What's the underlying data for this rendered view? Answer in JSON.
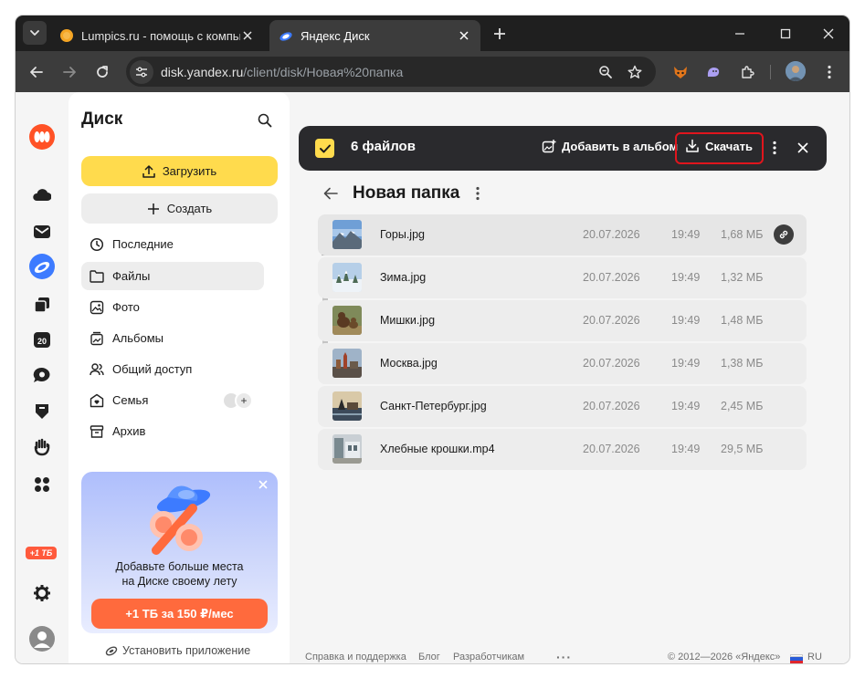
{
  "browser": {
    "tabs": [
      {
        "title": "Lumpics.ru - помощь с компьютером",
        "favicon": "orange-circle-icon"
      },
      {
        "title": "Яндекс Диск",
        "favicon": "yandex-disk-icon"
      }
    ],
    "url": {
      "host": "disk.yandex.ru",
      "path": "/client/disk/Новая%20папка"
    }
  },
  "sidebar": {
    "title": "Диск",
    "upload_label": "Загрузить",
    "create_label": "Создать",
    "nav_items": [
      {
        "label": "Последние",
        "icon": "clock-icon"
      },
      {
        "label": "Файлы",
        "icon": "folder-icon"
      },
      {
        "label": "Фото",
        "icon": "photo-icon"
      },
      {
        "label": "Альбомы",
        "icon": "albums-icon"
      },
      {
        "label": "Общий доступ",
        "icon": "users-icon"
      },
      {
        "label": "Семья",
        "icon": "family-icon"
      },
      {
        "label": "Архив",
        "icon": "archive-icon"
      }
    ],
    "family_plus": "+",
    "promo": {
      "text_line1": "Добавьте больше места",
      "text_line2": "на Диске своему лету",
      "button_label": "+1 ТБ за 150 ₽/мес"
    },
    "install_app_label": "Установить приложение"
  },
  "rail": {
    "badge": "+1 ТБ",
    "icons": [
      "yandex-logo-icon",
      "cloud-icon",
      "mail-icon",
      "disk-icon",
      "copy-icon",
      "calendar-icon",
      "messenger-icon",
      "shield-icon",
      "hand-icon",
      "apps-icon",
      "storage-icon",
      "settings-icon",
      "avatar-icon"
    ]
  },
  "selection_bar": {
    "count_label": "6 файлов",
    "add_to_album_label": "Добавить в альбом",
    "download_label": "Скачать"
  },
  "folder": {
    "title": "Новая папка",
    "files": [
      {
        "name": "Горы.jpg",
        "date": "20.07.2026",
        "time": "19:49",
        "size": "1,68 МБ",
        "thumb": "mountains"
      },
      {
        "name": "Зима.jpg",
        "date": "20.07.2026",
        "time": "19:49",
        "size": "1,32 МБ",
        "thumb": "winter"
      },
      {
        "name": "Мишки.jpg",
        "date": "20.07.2026",
        "time": "19:49",
        "size": "1,48 МБ",
        "thumb": "bears"
      },
      {
        "name": "Москва.jpg",
        "date": "20.07.2026",
        "time": "19:49",
        "size": "1,38 МБ",
        "thumb": "moscow"
      },
      {
        "name": "Санкт-Петербург.jpg",
        "date": "20.07.2026",
        "time": "19:49",
        "size": "2,45 МБ",
        "thumb": "spb"
      },
      {
        "name": "Хлебные крошки.mp4",
        "date": "20.07.2026",
        "time": "19:49",
        "size": "29,5 МБ",
        "thumb": "breadcrumbs"
      }
    ]
  },
  "footer": {
    "help": "Справка и поддержка",
    "blog": "Блог",
    "developers": "Разработчикам",
    "more": "···",
    "copyright": "© 2012—2026 «Яндекс»",
    "lang": "RU"
  },
  "colors": {
    "accent_yellow": "#ffdb4d",
    "promo_orange": "#ff6a3d",
    "highlight_red": "#e0151d",
    "selection_bar": "#2a2a2d"
  }
}
